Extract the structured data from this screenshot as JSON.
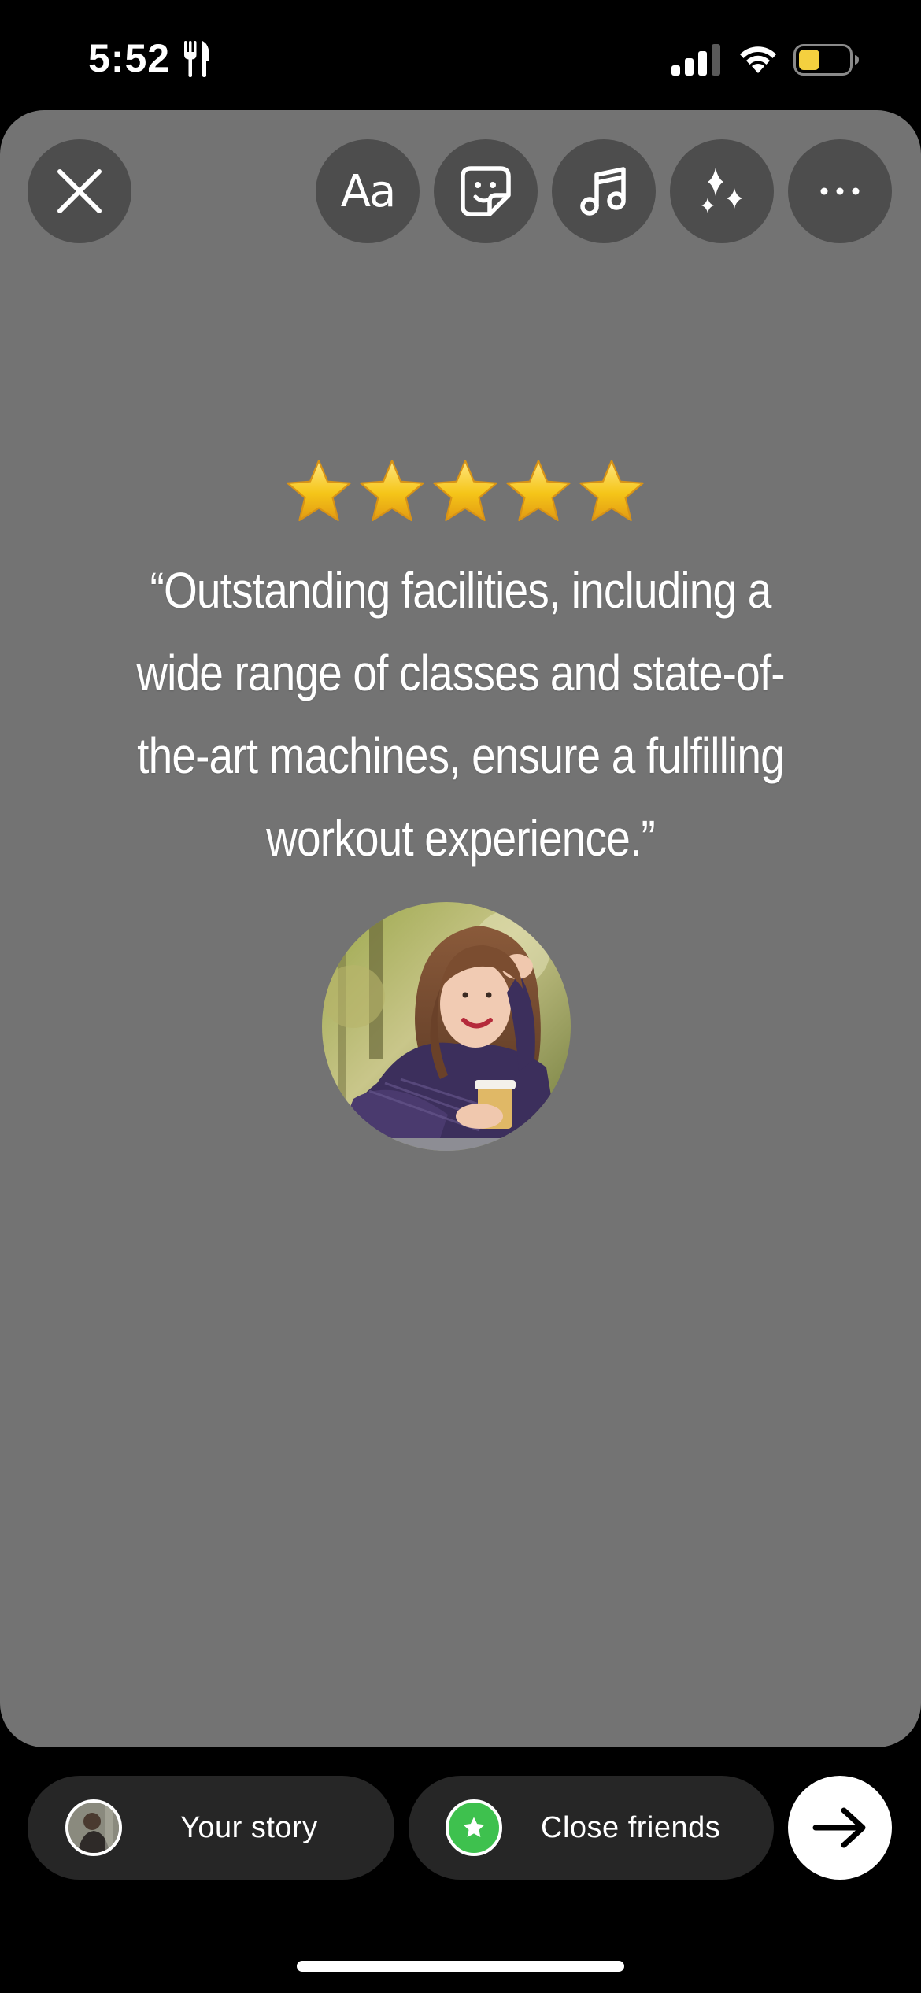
{
  "status_bar": {
    "time": "5:52",
    "activity_icon": "fork-knife-icon",
    "signal_icon": "cellular-signal-icon",
    "wifi_icon": "wifi-icon",
    "battery_icon": "battery-low-icon",
    "battery_color": "#f4d03f"
  },
  "toolbar": {
    "close_icon": "close-icon",
    "text_label": "Aa",
    "sticker_icon": "sticker-icon",
    "music_icon": "music-note-icon",
    "effects_icon": "sparkles-icon",
    "more_icon": "more-icon"
  },
  "review": {
    "rating": 5,
    "rating_max": 5,
    "quote": "“Outstanding facilities, including a wide range of classes and state-of-the-art machines, ensure a fulfilling workout experience.”",
    "reviewer_photo": "reviewer-photo"
  },
  "share": {
    "your_story_label": "Your story",
    "close_friends_label": "Close friends",
    "close_friends_color": "#3ec14e",
    "next_icon": "arrow-right-icon"
  },
  "colors": {
    "canvas_background": "#737373",
    "tool_button": "#4d4d4d",
    "pill_background": "#262626",
    "star_gold": "#f5c518"
  }
}
